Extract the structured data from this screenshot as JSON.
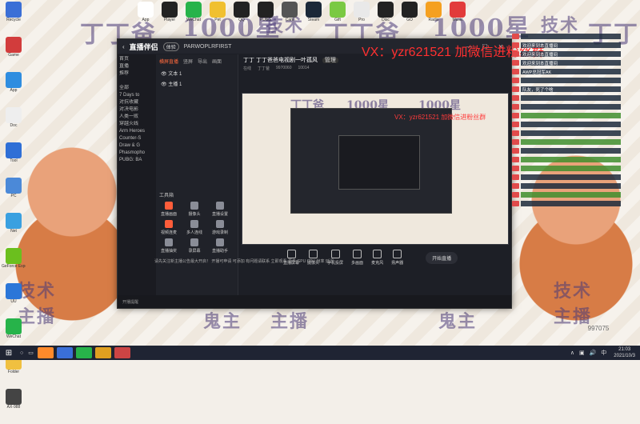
{
  "wallpaper": {
    "watermarks": [
      "丁丁爸",
      "1000星",
      "技术",
      "丁丁爸",
      "1000星",
      "技术",
      "丁丁"
    ],
    "side_captions": [
      "技术",
      "主播",
      "技术",
      "主播"
    ],
    "bottom_captions": [
      "鬼主",
      "主播",
      "鬼主"
    ]
  },
  "desktop_icons": [
    {
      "label": "Recycle",
      "color": "#3b6fd6"
    },
    {
      "label": "Game",
      "color": "#d23c3c"
    },
    {
      "label": "App",
      "color": "#2f8de0"
    },
    {
      "label": "Doc",
      "color": "#eee"
    },
    {
      "label": "Tool",
      "color": "#2f6fd6"
    },
    {
      "label": "PC",
      "color": "#4b89d8"
    },
    {
      "label": "Net",
      "color": "#3aa0e0"
    },
    {
      "label": "GeForce Experience",
      "color": "#6bbf1e"
    },
    {
      "label": "UU",
      "color": "#2b76d8"
    },
    {
      "label": "WeChat",
      "color": "#27b34a"
    },
    {
      "label": "Folder",
      "color": "#f0c040"
    },
    {
      "label": "AX-988",
      "color": "#444"
    }
  ],
  "top_icons": [
    {
      "label": "App",
      "color": "#fff"
    },
    {
      "label": "Player",
      "color": "#222"
    },
    {
      "label": "WeChat",
      "color": "#27b34a"
    },
    {
      "label": "Pet",
      "color": "#f0c030"
    },
    {
      "label": "QQ",
      "color": "#222"
    },
    {
      "label": "PUBG",
      "color": "#222"
    },
    {
      "label": "Cam",
      "color": "#555"
    },
    {
      "label": "Steam",
      "color": "#1b2838"
    },
    {
      "label": "Gift",
      "color": "#7ac943"
    },
    {
      "label": "Pro",
      "color": "#e9e9e9"
    },
    {
      "label": "Disc",
      "color": "#222"
    },
    {
      "label": "GO",
      "color": "#222"
    },
    {
      "label": "Radio",
      "color": "#f5a020"
    },
    {
      "label": "Music",
      "color": "#e23b3b"
    }
  ],
  "window": {
    "app_name": "直播伴侣",
    "version": "体验",
    "title_extra": "PARWOPLRFIRST",
    "tabs": [
      "横屏直播",
      "竖屏",
      "导出",
      "画面"
    ],
    "sources": [
      "文本 1",
      "主播 1"
    ],
    "side_items": [
      "首页",
      "直播",
      "推荐",
      "",
      "全部",
      "7 Days to",
      "对抗收藏",
      "对决电影",
      "人类一败",
      "穿越火线",
      "Arm Heroes",
      "Counter-S",
      "Draw & G",
      "Phasmopho",
      "PUBG: BA"
    ],
    "tool_header": "工具箱",
    "tools": [
      {
        "label": "直播画面",
        "hot": true
      },
      {
        "label": "摄像头",
        "hot": false
      },
      {
        "label": "直播设置",
        "hot": false
      },
      {
        "label": "视频连麦",
        "hot": true
      },
      {
        "label": "多人连线",
        "hot": false
      },
      {
        "label": "游戏录制",
        "hot": false
      },
      {
        "label": "直播抽奖",
        "hot": false
      },
      {
        "label": "录屏幕",
        "hot": false
      },
      {
        "label": "直播助手",
        "hot": false
      }
    ],
    "stream_title": "丁丁 丁丁爸爸电视剧一叶孤风",
    "stream_btn": "管理",
    "stats": [
      "在线",
      "丁丁爸",
      "9970060",
      "10014"
    ],
    "controls": [
      "直播屏幕",
      "摄像头",
      "手机投屏",
      "多画面",
      "麦克风",
      "扬声器"
    ],
    "start_label": "开始直播",
    "ticker": "请先关注新主播公告最大开启！ 开播可申请 可添加 有问题请联系 立即观看 更多 GPU CPU 帧率 延迟",
    "status": "开播提醒"
  },
  "overlay": {
    "vx_text": "VX：yzr621521 加微信进粉丝群"
  },
  "chat": {
    "messages": [
      {
        "text": "",
        "green": false
      },
      {
        "text": "欢迎来到本直播间",
        "green": false
      },
      {
        "text": "欢迎来到本直播间",
        "green": false
      },
      {
        "text": "欢迎来到本直播间",
        "green": false
      },
      {
        "text": "AWP总冠军AK",
        "green": false
      },
      {
        "text": "",
        "green": false
      },
      {
        "text": "队友，死了个啥",
        "green": false
      },
      {
        "text": "",
        "green": false
      },
      {
        "text": "",
        "green": false
      },
      {
        "text": "",
        "green": true
      },
      {
        "text": "",
        "green": false
      },
      {
        "text": "",
        "green": false
      },
      {
        "text": "",
        "green": true
      },
      {
        "text": "",
        "green": false
      },
      {
        "text": "",
        "green": true
      },
      {
        "text": "",
        "green": true
      },
      {
        "text": "",
        "green": false
      },
      {
        "text": "",
        "green": false
      },
      {
        "text": "",
        "green": true
      },
      {
        "text": "",
        "green": false
      }
    ]
  },
  "viewers": "997075",
  "taskbar": {
    "start": "⊞",
    "time": "21:03",
    "date": "2021/10/3",
    "tray": [
      "∧",
      "▣",
      "🔊",
      "中"
    ],
    "apps": [
      "#ff8a2b",
      "#3a6fd8",
      "#27b34a",
      "#e0a020",
      "#c44"
    ]
  }
}
